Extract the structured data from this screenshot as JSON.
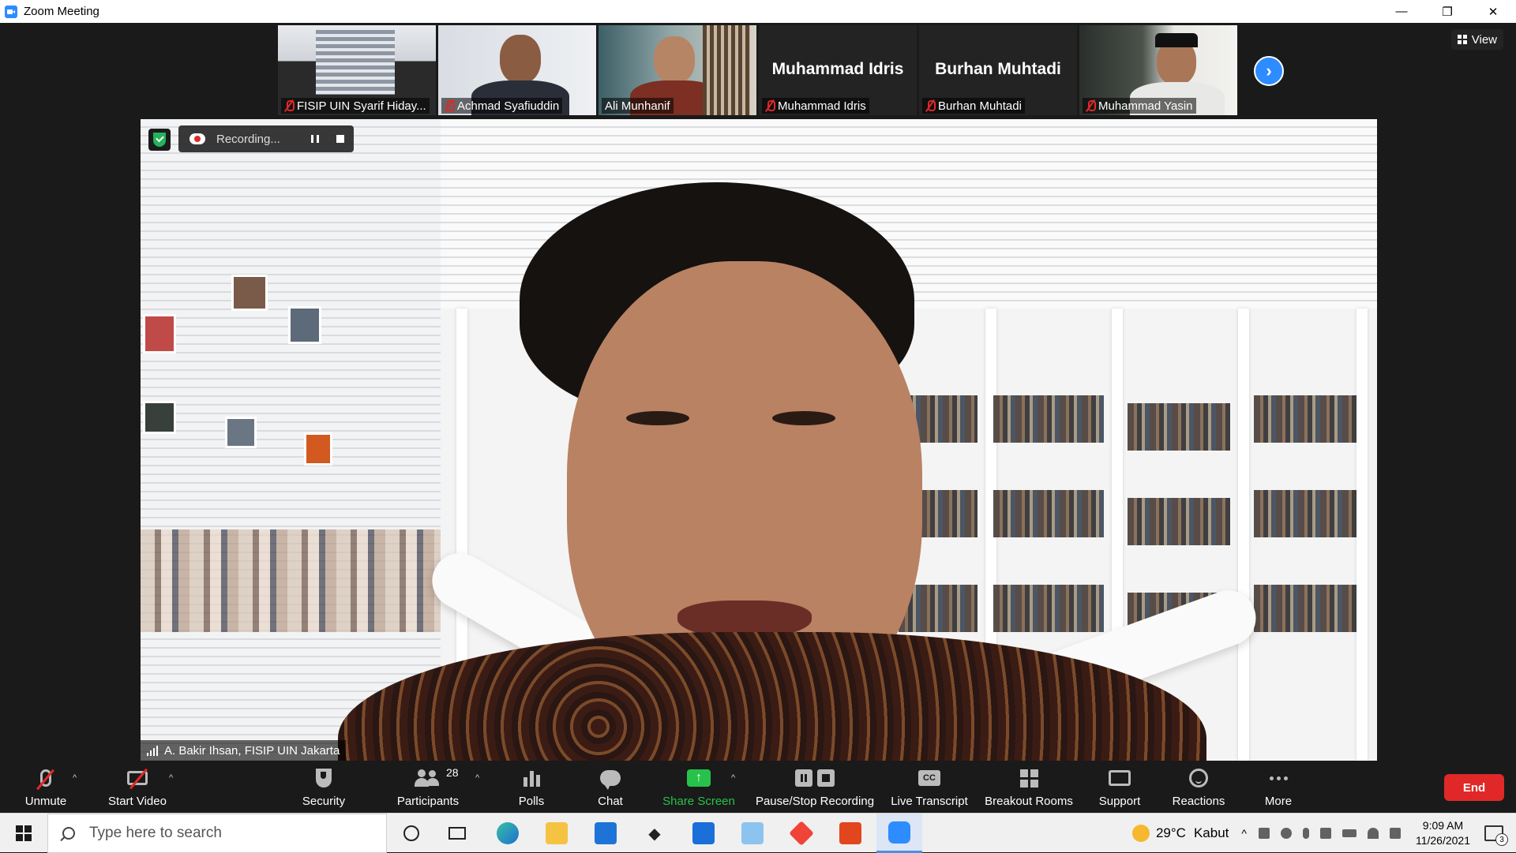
{
  "window": {
    "title": "Zoom Meeting",
    "minimize": "—",
    "restore": "❐",
    "close": "✕"
  },
  "strip": {
    "participants": [
      {
        "name": "FISIP UIN Syarif Hiday...",
        "has_video": true,
        "muted": true
      },
      {
        "name": "Achmad Syafiuddin",
        "has_video": true,
        "muted": true
      },
      {
        "name": "Ali Munhanif",
        "has_video": true,
        "muted": false
      },
      {
        "name": "Muhammad Idris",
        "has_video": false,
        "muted": true,
        "display_name": "Muhammad Idris"
      },
      {
        "name": "Burhan Muhtadi",
        "has_video": false,
        "muted": true,
        "display_name": "Burhan Muhtadi"
      },
      {
        "name": "Muhammad Yasin",
        "has_video": true,
        "muted": true
      }
    ],
    "next_label": "›",
    "view_label": "View"
  },
  "main": {
    "recording_text": "Recording...",
    "speaker_name": "A. Bakir Ihsan, FISIP UIN Jakarta"
  },
  "toolbar": {
    "unmute": "Unmute",
    "start_video": "Start Video",
    "security": "Security",
    "participants": "Participants",
    "participants_count": "28",
    "polls": "Polls",
    "chat": "Chat",
    "share_screen": "Share Screen",
    "share_arrow": "↑",
    "pause_stop_recording": "Pause/Stop Recording",
    "live_transcript": "Live Transcript",
    "cc": "CC",
    "breakout_rooms": "Breakout Rooms",
    "support": "Support",
    "reactions": "Reactions",
    "more": "More",
    "end": "End",
    "caret": "^"
  },
  "taskbar": {
    "search_placeholder": "Type here to search",
    "weather_temp": "29°C",
    "weather_desc": "Kabut",
    "time": "9:09 AM",
    "date": "11/26/2021",
    "notifications_count": "3",
    "tray_caret": "^"
  },
  "colors": {
    "accent": "#2D8CFF",
    "end_red": "#E02828",
    "share_green": "#27C24C"
  }
}
